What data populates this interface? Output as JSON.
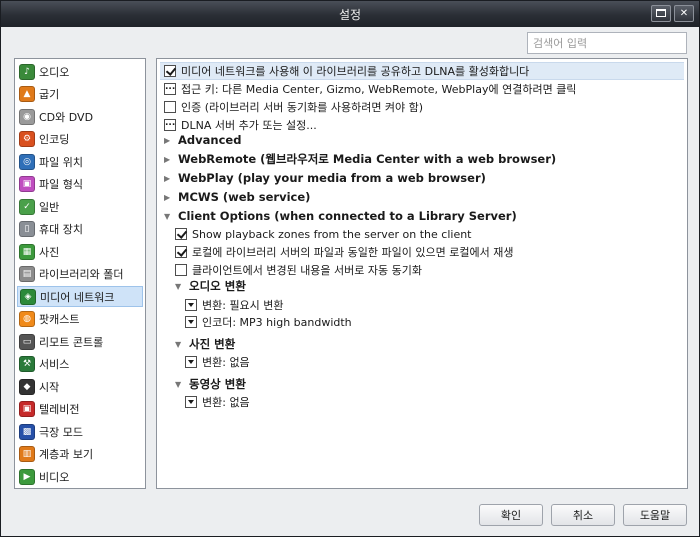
{
  "window": {
    "title": "설정"
  },
  "search": {
    "placeholder": "검색어 입력"
  },
  "sidebar": {
    "items": [
      {
        "label": "오디오",
        "icon": "speaker-icon",
        "color": "#3a8a3a"
      },
      {
        "label": "굽기",
        "icon": "flame-icon",
        "color": "#e07a1a"
      },
      {
        "label": "CD와 DVD",
        "icon": "disc-icon",
        "color": "#9a9a9a"
      },
      {
        "label": "인코딩",
        "icon": "encode-icon",
        "color": "#d9501f"
      },
      {
        "label": "파일 위치",
        "icon": "folder-globe-icon",
        "color": "#2f6fb8"
      },
      {
        "label": "파일 형식",
        "icon": "file-types-icon",
        "color": "#c04ec0"
      },
      {
        "label": "일반",
        "icon": "check-icon",
        "color": "#4aa04a"
      },
      {
        "label": "휴대 장치",
        "icon": "device-icon",
        "color": "#8a8f96"
      },
      {
        "label": "사진",
        "icon": "photo-icon",
        "color": "#3d9a3d"
      },
      {
        "label": "라이브러리와 폴더",
        "icon": "library-icon",
        "color": "#8c8c8c"
      },
      {
        "label": "미디어 네트워크",
        "icon": "network-icon",
        "color": "#2c8a3a"
      },
      {
        "label": "팟캐스트",
        "icon": "podcast-icon",
        "color": "#f08a1a"
      },
      {
        "label": "리모트 콘트롤",
        "icon": "remote-icon",
        "color": "#555"
      },
      {
        "label": "서비스",
        "icon": "services-icon",
        "color": "#2a7a3a"
      },
      {
        "label": "시작",
        "icon": "startup-icon",
        "color": "#333"
      },
      {
        "label": "텔레비전",
        "icon": "tv-icon",
        "color": "#c62a2a"
      },
      {
        "label": "극장 모드",
        "icon": "theater-icon",
        "color": "#2650a8"
      },
      {
        "label": "계층과 보기",
        "icon": "views-icon",
        "color": "#e07a1a"
      },
      {
        "label": "비디오",
        "icon": "video-icon",
        "color": "#3d9a3d"
      }
    ],
    "selected": "미디어 네트워크"
  },
  "panel": {
    "main_option": "미디어 네트워크를 사용해 이 라이브러리를 공유하고 DLNA를 활성화합니다",
    "access_key": "접근 키: 다른 Media Center, Gizmo, WebRemote, WebPlay에 연결하려면 클릭",
    "auth": "인증 (라이브러리 서버 동기화를 사용하려면 켜야 함)",
    "dlna_add": "DLNA 서버 추가 또는 설정...",
    "advanced": "Advanced",
    "webremote": "WebRemote (웹브라우저로 Media Center with a web browser)",
    "webplay": "WebPlay (play your media from a web browser)",
    "mcws": "MCWS (web service)",
    "client_options": "Client Options (when connected to a Library Server)",
    "show_zones": "Show playback zones from the server on the client",
    "local_play": "로컬에 라이브러리 서버의 파일과 동일한 파일이 있으면 로컬에서 재생",
    "client_sync": "클라이언트에서 변경된 내용을 서버로 자동 동기화",
    "audio_conv": "오디오 변환",
    "audio_conv_mode": "변환: 필요시 변환",
    "audio_encoder": "인코더: MP3 high bandwidth",
    "photo_conv": "사진 변환",
    "photo_conv_mode": "변환: 없음",
    "video_conv": "동영상 변환",
    "video_conv_mode": "변환: 없음"
  },
  "buttons": {
    "ok": "확인",
    "cancel": "취소",
    "help": "도움말"
  }
}
